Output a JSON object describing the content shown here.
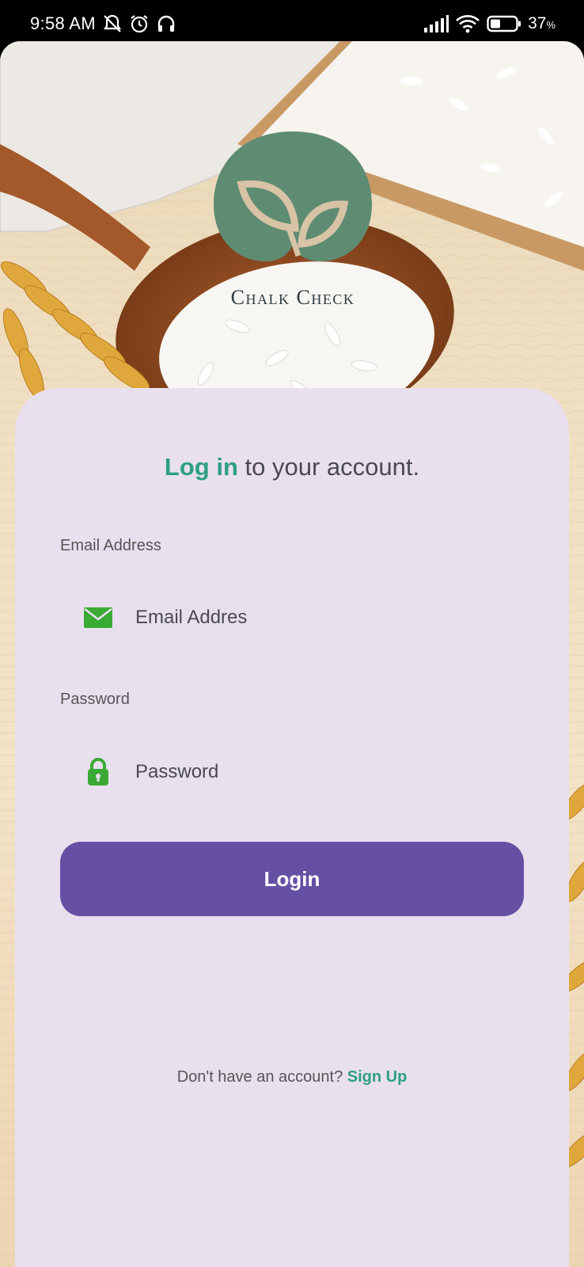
{
  "status_bar": {
    "time": "9:58 AM",
    "battery": "37",
    "battery_unit": "%",
    "icons": [
      "mute-icon",
      "alarm-icon",
      "headset-icon",
      "signal-icon",
      "wifi-icon",
      "battery-icon"
    ]
  },
  "brand": {
    "name": "Chalk Check",
    "logo_color": "#5e8c72",
    "leaf_color": "#d8c3a6"
  },
  "login": {
    "heading_accent": "Log in",
    "heading_rest": " to your account.",
    "email_label": "Email Address",
    "email_placeholder": "Email Addres",
    "email_icon": "envelope-icon",
    "password_label": "Password",
    "password_placeholder": "Password",
    "password_icon": "lock-icon",
    "button_label": "Login",
    "signup_prompt": "Don't have an account? ",
    "signup_link": "Sign Up"
  },
  "colors": {
    "accent": "#2e9e86",
    "button": "#6650a4",
    "card": "#e8e0ee",
    "icon_green": "#3aaa35"
  }
}
